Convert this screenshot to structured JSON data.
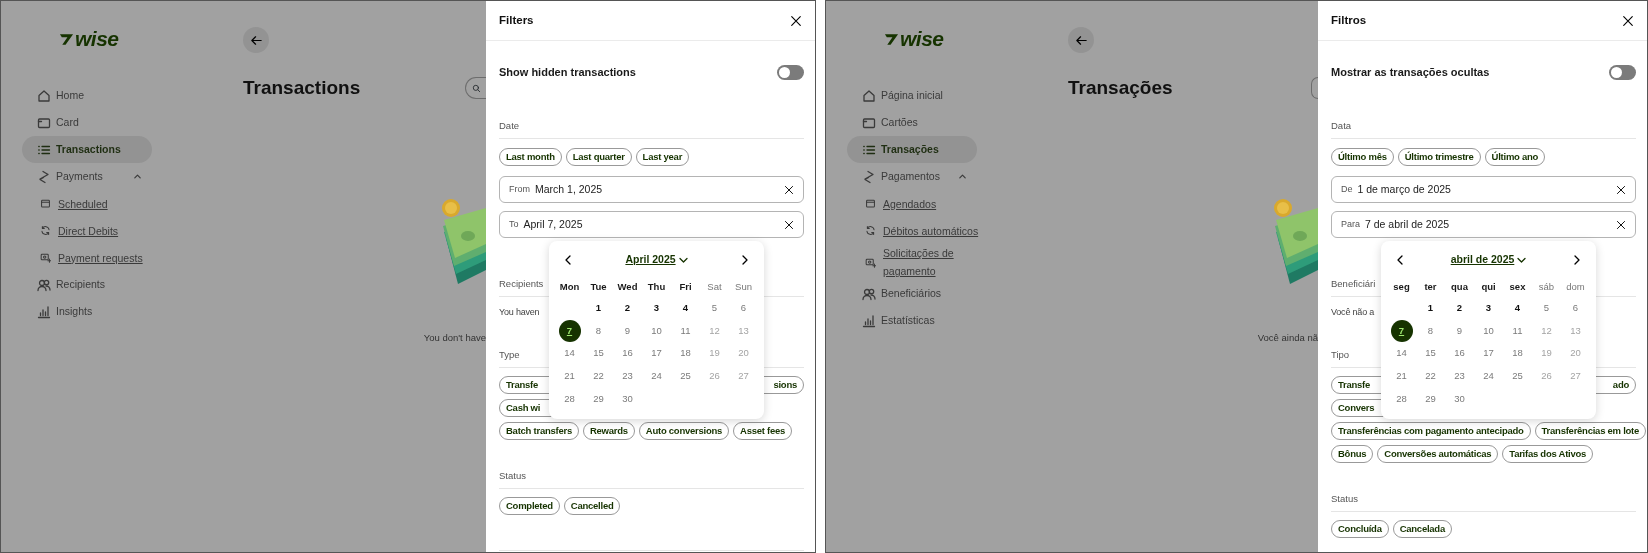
{
  "screens": [
    {
      "logo": "wise",
      "nav": [
        {
          "label": "Home",
          "selected": false
        },
        {
          "label": "Card",
          "selected": false
        },
        {
          "label": "Transactions",
          "selected": true
        },
        {
          "label": "Payments",
          "selected": false,
          "expanded": true,
          "children": [
            {
              "label": "Scheduled"
            },
            {
              "label": "Direct Debits"
            },
            {
              "label": "Payment requests"
            }
          ]
        },
        {
          "label": "Recipients",
          "selected": false
        },
        {
          "label": "Insights",
          "selected": false
        }
      ],
      "title": "Transactions",
      "search_field": {
        "icon_visible": true
      },
      "empty_text": "You don't have",
      "filters": {
        "title": "Filters",
        "hidden_toggle": {
          "label": "Show hidden transactions",
          "on": false
        },
        "date": {
          "label": "Date",
          "presets": [
            "Last month",
            "Last quarter",
            "Last year"
          ],
          "from": {
            "label": "From",
            "value": "March 1, 2025"
          },
          "to": {
            "label": "To",
            "value": "April 7, 2025"
          }
        },
        "calendar": {
          "month": "April 2025",
          "weekdays": [
            {
              "label": "Mon",
              "kind": "weekday"
            },
            {
              "label": "Tue",
              "kind": "weekday"
            },
            {
              "label": "Wed",
              "kind": "weekday"
            },
            {
              "label": "Thu",
              "kind": "weekday"
            },
            {
              "label": "Fri",
              "kind": "weekday"
            },
            {
              "label": "Sat",
              "kind": "weekend"
            },
            {
              "label": "Sun",
              "kind": "weekend"
            }
          ],
          "weeks": [
            [
              {
                "d": "1",
                "kind": "strong",
                "selected": false
              },
              {
                "d": "2",
                "kind": "strong",
                "selected": false
              },
              {
                "d": "3",
                "kind": "strong",
                "selected": false
              },
              {
                "d": "4",
                "kind": "strong",
                "selected": false
              },
              {
                "d": "5",
                "kind": "plain",
                "selected": false
              },
              {
                "d": "6",
                "kind": "plain",
                "selected": false
              }
            ],
            [
              {
                "d": "7",
                "kind": "strong",
                "selected": true
              },
              {
                "d": "8",
                "kind": "plain",
                "selected": false
              },
              {
                "d": "9",
                "kind": "plain",
                "selected": false
              },
              {
                "d": "10",
                "kind": "plain",
                "selected": false
              },
              {
                "d": "11",
                "kind": "plain",
                "selected": false
              },
              {
                "d": "12",
                "kind": "faint",
                "selected": false
              },
              {
                "d": "13",
                "kind": "faint",
                "selected": false
              }
            ],
            [
              {
                "d": "14",
                "kind": "plain",
                "selected": false
              },
              {
                "d": "15",
                "kind": "plain",
                "selected": false
              },
              {
                "d": "16",
                "kind": "plain",
                "selected": false
              },
              {
                "d": "17",
                "kind": "plain",
                "selected": false
              },
              {
                "d": "18",
                "kind": "plain",
                "selected": false
              },
              {
                "d": "19",
                "kind": "faint",
                "selected": false
              },
              {
                "d": "20",
                "kind": "faint",
                "selected": false
              }
            ],
            [
              {
                "d": "21",
                "kind": "plain",
                "selected": false
              },
              {
                "d": "22",
                "kind": "plain",
                "selected": false
              },
              {
                "d": "23",
                "kind": "plain",
                "selected": false
              },
              {
                "d": "24",
                "kind": "plain",
                "selected": false
              },
              {
                "d": "25",
                "kind": "plain",
                "selected": false
              },
              {
                "d": "26",
                "kind": "faint",
                "selected": false
              },
              {
                "d": "27",
                "kind": "faint",
                "selected": false
              }
            ],
            [
              {
                "d": "28",
                "kind": "plain",
                "selected": false
              },
              {
                "d": "29",
                "kind": "plain",
                "selected": false
              },
              {
                "d": "30",
                "kind": "plain",
                "selected": false
              }
            ]
          ]
        },
        "recipients": {
          "label": "Recipients",
          "text": "You haven"
        },
        "type": {
          "label": "Type",
          "chip_rows": [
            [
              {
                "text": "Transfe",
                "kind": "cut-right"
              },
              {
                "text": "sions",
                "kind": "cut-left"
              }
            ],
            [
              {
                "text": "Cash wi",
                "kind": "cut-right"
              }
            ],
            [
              {
                "text": "Batch transfers",
                "kind": "whole"
              },
              {
                "text": "Rewards",
                "kind": "whole"
              },
              {
                "text": "Auto conversions",
                "kind": "whole"
              },
              {
                "text": "Asset fees",
                "kind": "whole"
              }
            ]
          ]
        },
        "status": {
          "label": "Status",
          "chips": [
            "Completed",
            "Cancelled"
          ]
        }
      }
    },
    {
      "logo": "wise",
      "nav": [
        {
          "label": "Página inicial",
          "selected": false
        },
        {
          "label": "Cartões",
          "selected": false
        },
        {
          "label": "Transações",
          "selected": true
        },
        {
          "label": "Pagamentos",
          "selected": false,
          "expanded": true,
          "children": [
            {
              "label": "Agendados"
            },
            {
              "label": "Débitos automáticos"
            },
            {
              "label": "Solicitações de pagamento"
            }
          ]
        },
        {
          "label": "Beneficiários",
          "selected": false
        },
        {
          "label": "Estatísticas",
          "selected": false
        }
      ],
      "title": "Transações",
      "search_field": {
        "icon_visible": false
      },
      "empty_text": "Você ainda nã",
      "filters": {
        "title": "Filtros",
        "hidden_toggle": {
          "label": "Mostrar as transações ocultas",
          "on": false
        },
        "date": {
          "label": "Data",
          "presets": [
            "Último mês",
            "Último trimestre",
            "Último ano"
          ],
          "from": {
            "label": "De",
            "value": "1 de março de 2025"
          },
          "to": {
            "label": "Para",
            "value": "7 de abril de 2025"
          }
        },
        "calendar": {
          "month": "abril de 2025",
          "weekdays": [
            {
              "label": "seg",
              "kind": "weekday"
            },
            {
              "label": "ter",
              "kind": "weekday"
            },
            {
              "label": "qua",
              "kind": "weekday"
            },
            {
              "label": "qui",
              "kind": "weekday"
            },
            {
              "label": "sex",
              "kind": "weekday"
            },
            {
              "label": "sáb",
              "kind": "weekend"
            },
            {
              "label": "dom",
              "kind": "weekend"
            }
          ],
          "weeks": [
            [
              {
                "d": "1",
                "kind": "strong",
                "selected": false
              },
              {
                "d": "2",
                "kind": "strong",
                "selected": false
              },
              {
                "d": "3",
                "kind": "strong",
                "selected": false
              },
              {
                "d": "4",
                "kind": "strong",
                "selected": false
              },
              {
                "d": "5",
                "kind": "plain",
                "selected": false
              },
              {
                "d": "6",
                "kind": "plain",
                "selected": false
              }
            ],
            [
              {
                "d": "7",
                "kind": "strong",
                "selected": true
              },
              {
                "d": "8",
                "kind": "plain",
                "selected": false
              },
              {
                "d": "9",
                "kind": "plain",
                "selected": false
              },
              {
                "d": "10",
                "kind": "plain",
                "selected": false
              },
              {
                "d": "11",
                "kind": "plain",
                "selected": false
              },
              {
                "d": "12",
                "kind": "faint",
                "selected": false
              },
              {
                "d": "13",
                "kind": "faint",
                "selected": false
              }
            ],
            [
              {
                "d": "14",
                "kind": "plain",
                "selected": false
              },
              {
                "d": "15",
                "kind": "plain",
                "selected": false
              },
              {
                "d": "16",
                "kind": "plain",
                "selected": false
              },
              {
                "d": "17",
                "kind": "plain",
                "selected": false
              },
              {
                "d": "18",
                "kind": "plain",
                "selected": false
              },
              {
                "d": "19",
                "kind": "faint",
                "selected": false
              },
              {
                "d": "20",
                "kind": "faint",
                "selected": false
              }
            ],
            [
              {
                "d": "21",
                "kind": "plain",
                "selected": false
              },
              {
                "d": "22",
                "kind": "plain",
                "selected": false
              },
              {
                "d": "23",
                "kind": "plain",
                "selected": false
              },
              {
                "d": "24",
                "kind": "plain",
                "selected": false
              },
              {
                "d": "25",
                "kind": "plain",
                "selected": false
              },
              {
                "d": "26",
                "kind": "faint",
                "selected": false
              },
              {
                "d": "27",
                "kind": "faint",
                "selected": false
              }
            ],
            [
              {
                "d": "28",
                "kind": "plain",
                "selected": false
              },
              {
                "d": "29",
                "kind": "plain",
                "selected": false
              },
              {
                "d": "30",
                "kind": "plain",
                "selected": false
              }
            ]
          ]
        },
        "recipients": {
          "label": "Beneficiári",
          "text": "Você não a"
        },
        "type": {
          "label": "Tipo",
          "chip_rows": [
            [
              {
                "text": "Transfe",
                "kind": "cut-right"
              },
              {
                "text": "ado",
                "kind": "cut-left"
              }
            ],
            [
              {
                "text": "Convers",
                "kind": "cut-right"
              }
            ],
            [
              {
                "text": "Transferências com pagamento antecipado",
                "kind": "whole"
              },
              {
                "text": "Transferências em lote",
                "kind": "whole"
              }
            ],
            [
              {
                "text": "Bônus",
                "kind": "whole"
              },
              {
                "text": "Conversões automáticas",
                "kind": "whole"
              },
              {
                "text": "Tarifas dos Ativos",
                "kind": "whole"
              }
            ]
          ]
        },
        "status": {
          "label": "Status",
          "chips": [
            "Concluída",
            "Cancelada"
          ]
        }
      }
    }
  ]
}
